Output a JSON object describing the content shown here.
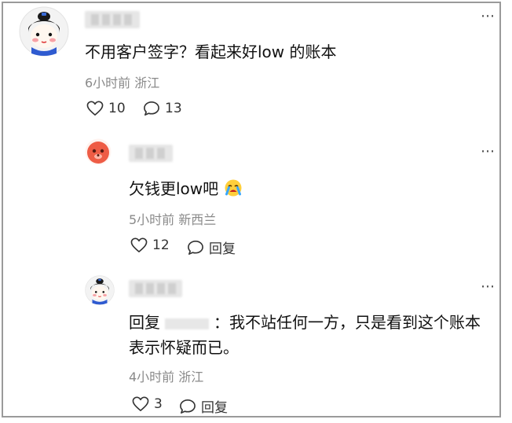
{
  "comments": [
    {
      "text": "不用客户签字？看起来好low 的账本",
      "meta": "6小时前 浙江",
      "likes": "10",
      "replies": "13"
    },
    {
      "text": "欠钱更low吧",
      "meta": "5小时前 新西兰",
      "likes": "12",
      "reply_label": "回复"
    },
    {
      "prefix": "回复",
      "text_line1": "：我不站任何一方，只是看到这个账本",
      "text_line2": "表示怀疑而已。",
      "meta": "4小时前 浙江",
      "likes": "3",
      "reply_label": "回复"
    }
  ],
  "icons": {
    "more": "more-icon",
    "like": "heart-outline-icon",
    "reply": "speech-bubble-outline-icon",
    "emoji": "crying-face-emoji-icon"
  }
}
